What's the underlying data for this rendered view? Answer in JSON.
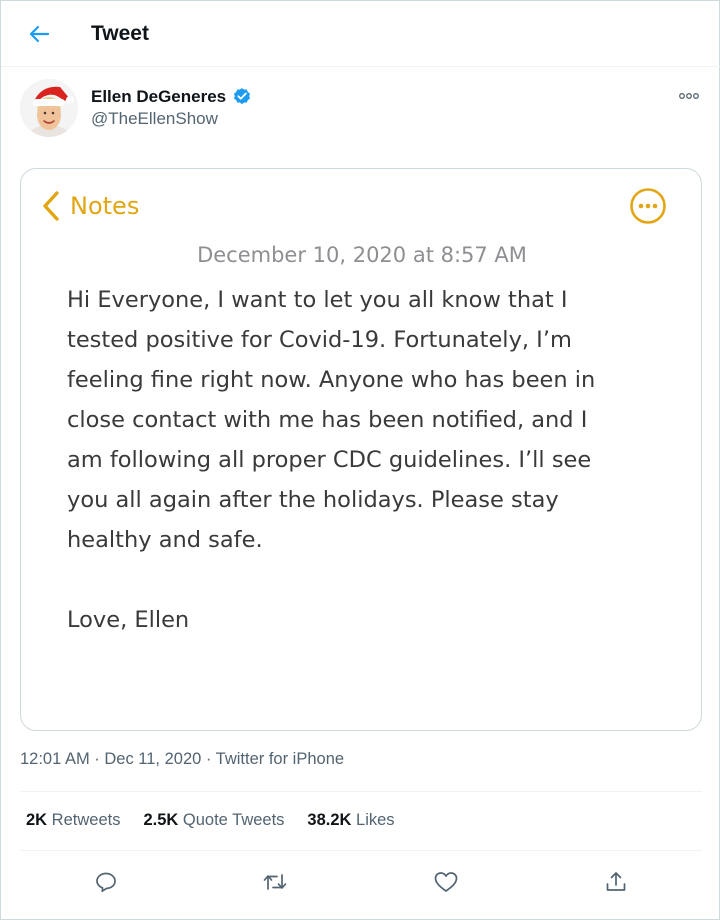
{
  "header": {
    "title": "Tweet",
    "back_icon": "arrow-left-icon"
  },
  "author": {
    "name": "Ellen DeGeneres",
    "handle": "@TheEllenShow",
    "verified": true
  },
  "note": {
    "back_label": "Notes",
    "date": "December 10, 2020 at 8:57 AM",
    "body": "Hi Everyone, I want to let you all know that I\ntested positive for Covid-19. Fortunately, I’m\nfeeling fine right now. Anyone who has been in\nclose contact with me has been notified, and I\nam following all proper CDC guidelines. I’ll see\nyou all again after the holidays. Please stay\nhealthy and safe.\n\nLove, Ellen"
  },
  "meta": {
    "text": "12:01 AM · Dec 11, 2020 · Twitter for iPhone"
  },
  "stats": {
    "retweets_count": "2K",
    "retweets_label": " Retweets",
    "quotes_count": "2.5K",
    "quotes_label": " Quote Tweets",
    "likes_count": "38.2K",
    "likes_label": " Likes"
  },
  "colors": {
    "twitter_blue": "#1d9bf0",
    "notes_yellow": "#e2a612",
    "secondary_text": "#536471"
  }
}
